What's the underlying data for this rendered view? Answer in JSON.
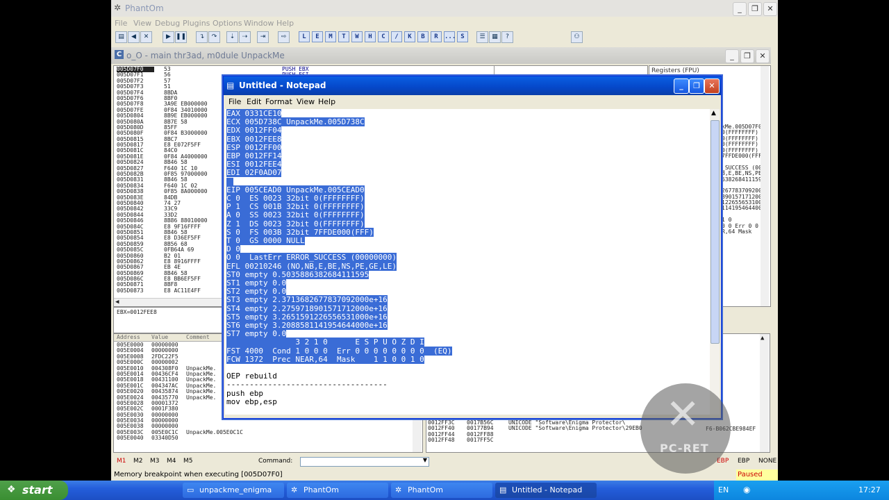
{
  "main": {
    "title": "PhantOm",
    "menu": [
      "File",
      "View",
      "Debug",
      "Plugins",
      "Options",
      "Window",
      "Help"
    ],
    "toolbar_letters": [
      "L",
      "E",
      "M",
      "T",
      "W",
      "H",
      "C",
      "/",
      "K",
      "B",
      "R",
      "...",
      "S"
    ]
  },
  "child": {
    "title": "o_O - main thr3ad, m0dule UnpackMe",
    "disasm_addrs": [
      "005D07F0",
      "005D07F1",
      "005D07F2",
      "005D07F3",
      "005D07F4",
      "005D07F6",
      "005D07F8",
      "005D07FE",
      "005D0804",
      "005D080A",
      "005D080D",
      "005D080F",
      "005D0815",
      "005D0817",
      "005D081C",
      "005D081E",
      "005D0824",
      "005D0827",
      "005D082B",
      "005D0831",
      "005D0834",
      "005D0838",
      "005D083E",
      "005D0840",
      "005D0842",
      "005D0844",
      "005D0846",
      "005D084C",
      "005D0851",
      "005D0854",
      "005D0859",
      "005D085C",
      "005D0860",
      "005D0862",
      "005D0867",
      "005D0869",
      "005D086C",
      "005D0871",
      "005D0873"
    ],
    "disasm_hex": [
      "53",
      "56",
      "57",
      "51",
      "8BDA",
      "8BF0",
      "3A9E EB000000",
      "0F84 34010000",
      "8B9E EB000000",
      "8B7E 58",
      "85FF",
      "0F84 B3000000",
      "8BC7",
      "E8 E072F5FF",
      "84C0",
      "0F84 A4000000",
      "8B46 58",
      "F640 1C 10",
      "0F85 97000000",
      "8B46 58",
      "F640 1C 02",
      "0F85 8A000000",
      "84DB",
      "74 27",
      "33C9",
      "33D2",
      "8B86 88010000",
      "E8 9F16FFFF",
      "8B46 58",
      "E8 D36EF5FF",
      "8B56 68",
      "0FB64A 69",
      "B2 01",
      "E8 8916FFFF",
      "EB 4E",
      "8B46 58",
      "E8 BB6EF5FF",
      "8BF8",
      "E8 AC11E4FF"
    ],
    "disasm_asm": [
      "PUSH EBX",
      "PUSH ESI"
    ],
    "info_line": "EBX=0012FEE8",
    "registers_header": "Registers (FPU)",
    "reg_fragments": [
      "kMe.005D07F0",
      "0(FFFFFFFF)",
      "0(FFFFFFFF)",
      "0(FFFFFFFF)",
      "0(FFFFFFFF)",
      "7FFDE000(FFF)",
      "",
      "_SUCCESS (00",
      "B,E,BE,NS,PE,",
      "6382684111595",
      "",
      "2677837092000",
      "8901571712000",
      "1226556531000",
      "1141954644000",
      "",
      "1 0",
      "0 0   Err 0 0",
      "R,64  Mask"
    ],
    "dump_headers": [
      "Address",
      "Value",
      "Comment"
    ],
    "dump_rows": [
      [
        "005E0000",
        "00000000",
        ""
      ],
      [
        "005E0004",
        "00000000",
        ""
      ],
      [
        "005E0008",
        "2FDC22F5",
        ""
      ],
      [
        "005E000C",
        "00000002",
        ""
      ],
      [
        "005E0010",
        "004308F0",
        "UnpackMe."
      ],
      [
        "005E0014",
        "00436CF4",
        "UnpackMe."
      ],
      [
        "005E0018",
        "00431100",
        "UnpackMe."
      ],
      [
        "005E001C",
        "004347AC",
        "UnpackMe."
      ],
      [
        "005E0020",
        "00435874",
        "UnpackMe."
      ],
      [
        "005E0024",
        "00435770",
        "UnpackMe."
      ],
      [
        "005E0028",
        "00001372",
        ""
      ],
      [
        "005E002C",
        "0001F380",
        ""
      ],
      [
        "005E0030",
        "00000000",
        ""
      ],
      [
        "005E0034",
        "00000000",
        ""
      ],
      [
        "005E0038",
        "00000000",
        ""
      ],
      [
        "005E003C",
        "005E0C1C",
        "UnpackMe.005E0C1C"
      ],
      [
        "005E0040",
        "03340D50",
        ""
      ]
    ],
    "stack_rows": [
      [
        "0012FF3C",
        "0017B56C",
        "UNICODE \"Software\\Enigma Protector\\"
      ],
      [
        "0012FF40",
        "00177B94",
        "UNICODE \"Software\\Enigma Protector\\29EB0"
      ],
      [
        "0012FF44",
        "0012FF88",
        ""
      ],
      [
        "0012FF48",
        "0017FF5C",
        ""
      ]
    ],
    "stack_tail": "F6-B062CBE984EF",
    "mem_tabs": [
      "M1",
      "M2",
      "M3",
      "M4",
      "M5"
    ],
    "command_label": "Command:",
    "reg_buttons": [
      "EBP",
      "EBP",
      "NONE"
    ]
  },
  "notepad": {
    "title": "Untitled - Notepad",
    "menu": [
      "File",
      "Edit",
      "Format",
      "View",
      "Help"
    ],
    "selected_lines": [
      "EAX 0331CE10",
      "ECX 005D738C UnpackMe.005D738C",
      "EDX 0012FF04",
      "EBX 0012FEE8",
      "ESP 0012FF00",
      "EBP 0012FF14",
      "ESI 0012FEE4",
      "EDI 02F0AD07",
      "",
      "EIP 005CEAD0 UnpackMe.005CEAD0",
      "C 0  ES 0023 32bit 0(FFFFFFFF)",
      "P 1  CS 001B 32bit 0(FFFFFFFF)",
      "A 0  SS 0023 32bit 0(FFFFFFFF)",
      "Z 1  DS 0023 32bit 0(FFFFFFFF)",
      "S 0  FS 003B 32bit 7FFDE000(FFF)",
      "T 0  GS 0000 NULL",
      "D 0",
      "O 0  LastErr ERROR_SUCCESS (00000000)",
      "EFL 00210246 (NO,NB,E,BE,NS,PE,GE,LE)",
      "ST0 empty 0.5035886382684111595",
      "ST1 empty 0.0",
      "ST2 empty 0.0",
      "ST3 empty 2.3713682677837092000e+16",
      "ST4 empty 2.2759718901571712000e+16",
      "ST5 empty 3.2651591226556531000e+16",
      "ST6 empty 3.2088581141954644000e+16",
      "ST7 empty 0.0",
      "               3 2 1 0      E S P U O Z D I",
      "FST 4000  Cond 1 0 0 0  Err 0 0 0 0 0 0 0 0  (EQ)",
      "FCW 1372  Prec NEAR,64  Mask    1 1 0 0 1 0"
    ],
    "plain_lines": [
      "",
      "OEP rebuild",
      "-----------------------------------",
      "push ebp",
      "mov ebp,esp"
    ]
  },
  "status": {
    "message": "Memory breakpoint when executing [005D07F0]",
    "state": "Paused"
  },
  "taskbar": {
    "start": "start",
    "tasks": [
      "unpackme_enigma",
      "PhantOm",
      "PhantOm",
      "Untitled - Notepad"
    ],
    "lang": "EN",
    "clock": "17:27"
  },
  "watermark": "PC-RET"
}
